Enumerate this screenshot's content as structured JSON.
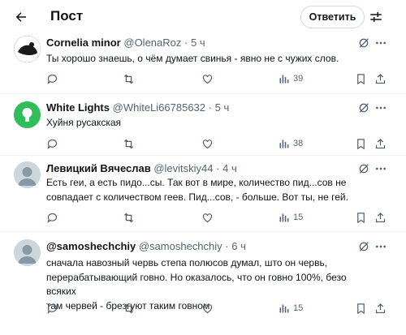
{
  "header": {
    "title": "Пост",
    "reply_button": "Ответить"
  },
  "replies": [
    {
      "name": "Cornelia minor",
      "handle": "@OlenaRoz",
      "separator": "·",
      "time": "5 ч",
      "text": "Ты хорошо знаешь, о чём думает свинья - явно не с чужих слов.",
      "views": "39"
    },
    {
      "name": "White Lights",
      "handle": "@WhiteLi66785632",
      "separator": "·",
      "time": "5 ч",
      "text": "Хуйня русакская",
      "views": "38"
    },
    {
      "name": "Левицкий Вячеслав",
      "handle": "@levitskiy44",
      "separator": "·",
      "time": "4 ч",
      "text_lines": [
        "Есть геи, а есть пидо...сы.  Так вот в мире, количество пид...сов не",
        "совпадает с количеством геев. Пид...сов, - больше. Вот ты, не гей."
      ],
      "views": "15"
    },
    {
      "name": "@samoshechchiy",
      "handle": "@samoshechchiy",
      "separator": "·",
      "time": "6 ч",
      "text_lines": [
        "сначала навозный червь степа полюсов думал, што он червь,",
        "перерабатывающий говно. Но оказалось, что он говно 100%, безо всяких",
        "там червей - брезгуют таким говном"
      ],
      "views": "15"
    }
  ],
  "colors": {
    "text": "#0f1419",
    "secondary": "#536471",
    "border": "#eff3f4",
    "avatar_default": "#ccd6dd"
  },
  "icons": [
    "back-arrow-icon",
    "settings-sliders-icon",
    "grok-icon",
    "more-icon",
    "reply-icon",
    "repost-icon",
    "like-icon",
    "views-icon",
    "bookmark-icon",
    "share-icon"
  ]
}
